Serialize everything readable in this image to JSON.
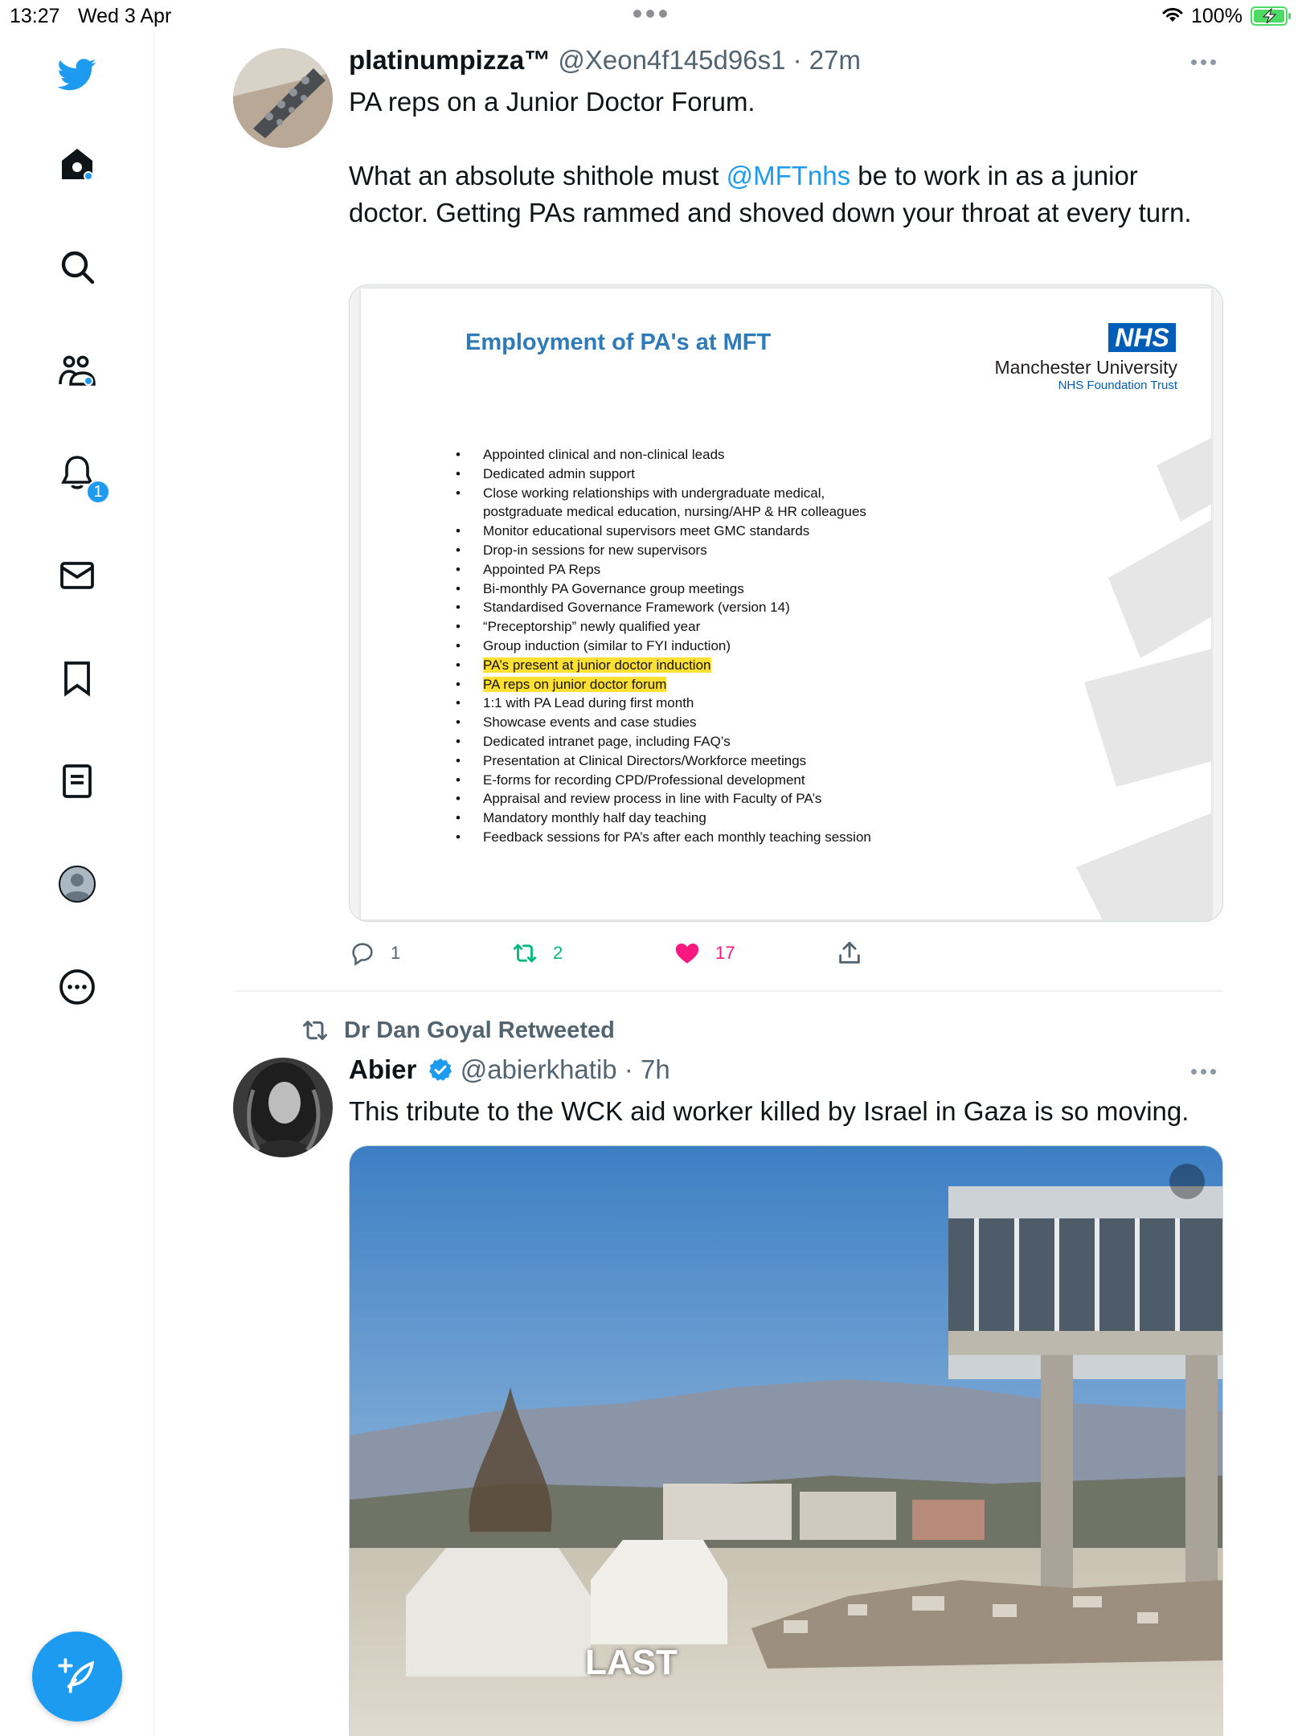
{
  "status_bar": {
    "time": "13:27",
    "date": "Wed 3 Apr",
    "battery": "100%"
  },
  "sidebar": {
    "items": [
      {
        "name": "twitter-logo"
      },
      {
        "name": "home",
        "has_dot": true
      },
      {
        "name": "explore"
      },
      {
        "name": "communities",
        "has_dot": true
      },
      {
        "name": "notifications",
        "badge": "1"
      },
      {
        "name": "messages"
      },
      {
        "name": "bookmarks"
      },
      {
        "name": "lists"
      },
      {
        "name": "profile"
      },
      {
        "name": "more"
      }
    ],
    "compose_icon": "compose-feather-icon"
  },
  "colors": {
    "accent": "#1d9bf0",
    "retweet": "#00ba7c",
    "like": "#f91880",
    "secondary_text": "#536471"
  },
  "tweets": [
    {
      "name": "platinumpizza™",
      "handle": "@Xeon4f145d96s1",
      "time": "27m",
      "text_line1": "PA reps on a Junior Doctor Forum.",
      "text_before_mention": "What an absolute shithole must ",
      "mention": "@MFTnhs",
      "text_after_mention": " be to work in as a junior doctor. Getting PAs rammed and shoved down your throat at every turn.",
      "slide": {
        "title": "Employment of PA's at MFT",
        "logo": "NHS",
        "org": "Manchester University",
        "org_sub": "NHS Foundation Trust",
        "bullets": [
          "Appointed clinical and non-clinical leads",
          "Dedicated admin support",
          "Close working relationships with undergraduate medical,",
          "postgraduate medical education, nursing/AHP & HR colleagues",
          "Monitor educational supervisors meet GMC standards",
          "Drop-in sessions for new supervisors",
          "Appointed PA Reps",
          "Bi-monthly PA Governance group meetings",
          "Standardised Governance Framework (version 14)",
          "“Preceptorship” newly qualified year",
          "Group induction (similar to FYI induction)",
          "PA’s present at junior doctor induction",
          "PA reps on junior doctor forum",
          "1:1 with PA Lead during first month",
          "Showcase events and case studies",
          "Dedicated intranet page, including FAQ’s",
          "Presentation at Clinical Directors/Workforce meetings",
          "E-forms for recording CPD/Professional development",
          "Appraisal and review process in line with Faculty of PA’s",
          "Mandatory monthly half day teaching",
          "Feedback sessions for PA’s after each monthly teaching session"
        ]
      },
      "replies": "1",
      "retweets": "2",
      "likes": "17",
      "liked": true
    },
    {
      "retweeted_by": "Dr Dan Goyal Retweeted",
      "name": "Abier",
      "verified": true,
      "handle": "@abierkhatib",
      "time": "7h",
      "text": "This tribute to the WCK aid worker killed by Israel in Gaza is so moving.",
      "video_caption": "LAST"
    }
  ]
}
